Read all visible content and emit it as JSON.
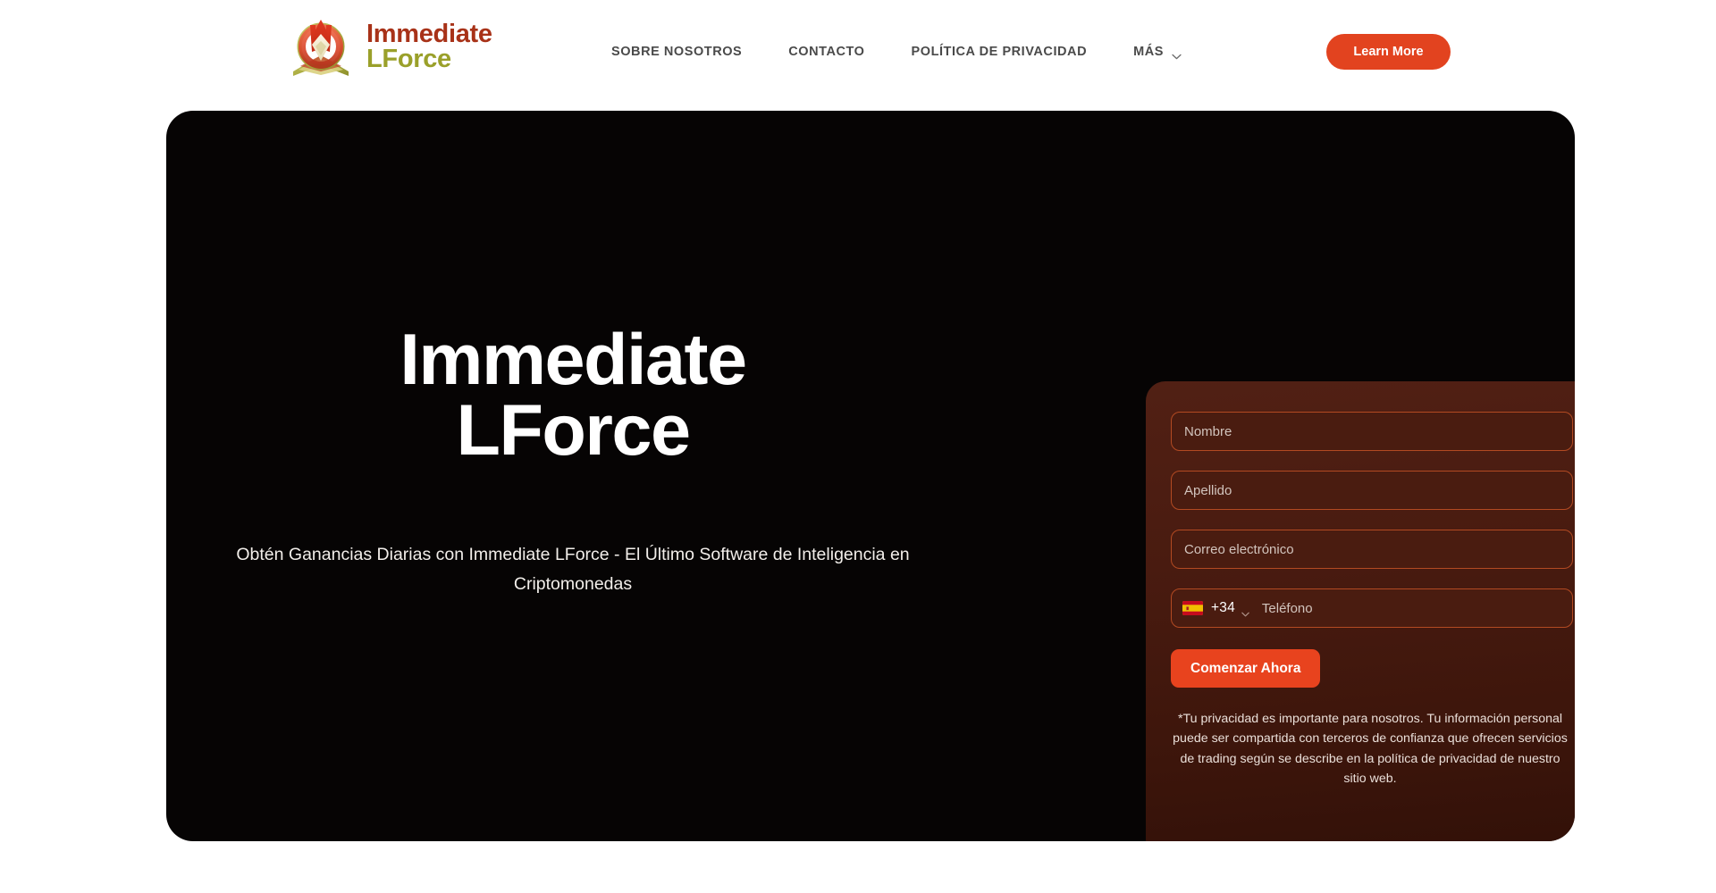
{
  "theme": {
    "page_background": "#ffffff",
    "hero_background": "#060404",
    "accent_orange": "#e2431f",
    "submit_orange": "#e8431e",
    "brand_red": "#a83218",
    "brand_olive": "#9aa02a",
    "card_gradient_top": "#512014",
    "card_gradient_bottom": "#2f0f07",
    "field_border": "#b34a22",
    "field_fill": "#4a1c10"
  },
  "header": {
    "brand": {
      "logo_icon": "flame-torch-logo-icon",
      "word_1": "Immediate",
      "word_2": "LForce"
    },
    "nav": [
      {
        "label": "SOBRE NOSOTROS",
        "has_dropdown": false
      },
      {
        "label": "CONTACTO",
        "has_dropdown": false
      },
      {
        "label": "POLÍTICA DE PRIVACIDAD",
        "has_dropdown": false
      },
      {
        "label": "MÁS",
        "has_dropdown": true,
        "caret_icon": "chevron-down-icon"
      }
    ],
    "cta_label": "Learn More"
  },
  "hero": {
    "title_line_1": "Immediate",
    "title_line_2": "LForce",
    "subtitle": "Obtén Ganancias Diarias con Immediate LForce - El Último Software de Inteligencia en Criptomonedas"
  },
  "form": {
    "fields": [
      {
        "name": "first-name",
        "placeholder": "Nombre",
        "value": ""
      },
      {
        "name": "last-name",
        "placeholder": "Apellido",
        "value": ""
      },
      {
        "name": "email",
        "placeholder": "Correo electrónico",
        "value": ""
      }
    ],
    "phone": {
      "flag_icon": "spain-flag-icon",
      "country": "España",
      "dial_code": "+34",
      "caret_icon": "chevron-down-icon",
      "placeholder": "Teléfono",
      "value": ""
    },
    "submit_label": "Comenzar Ahora",
    "disclaimer": "*Tu privacidad es importante para nosotros. Tu información personal puede ser compartida con terceros de confianza que ofrecen servicios de trading según se describe en la política de privacidad de nuestro sitio web."
  }
}
